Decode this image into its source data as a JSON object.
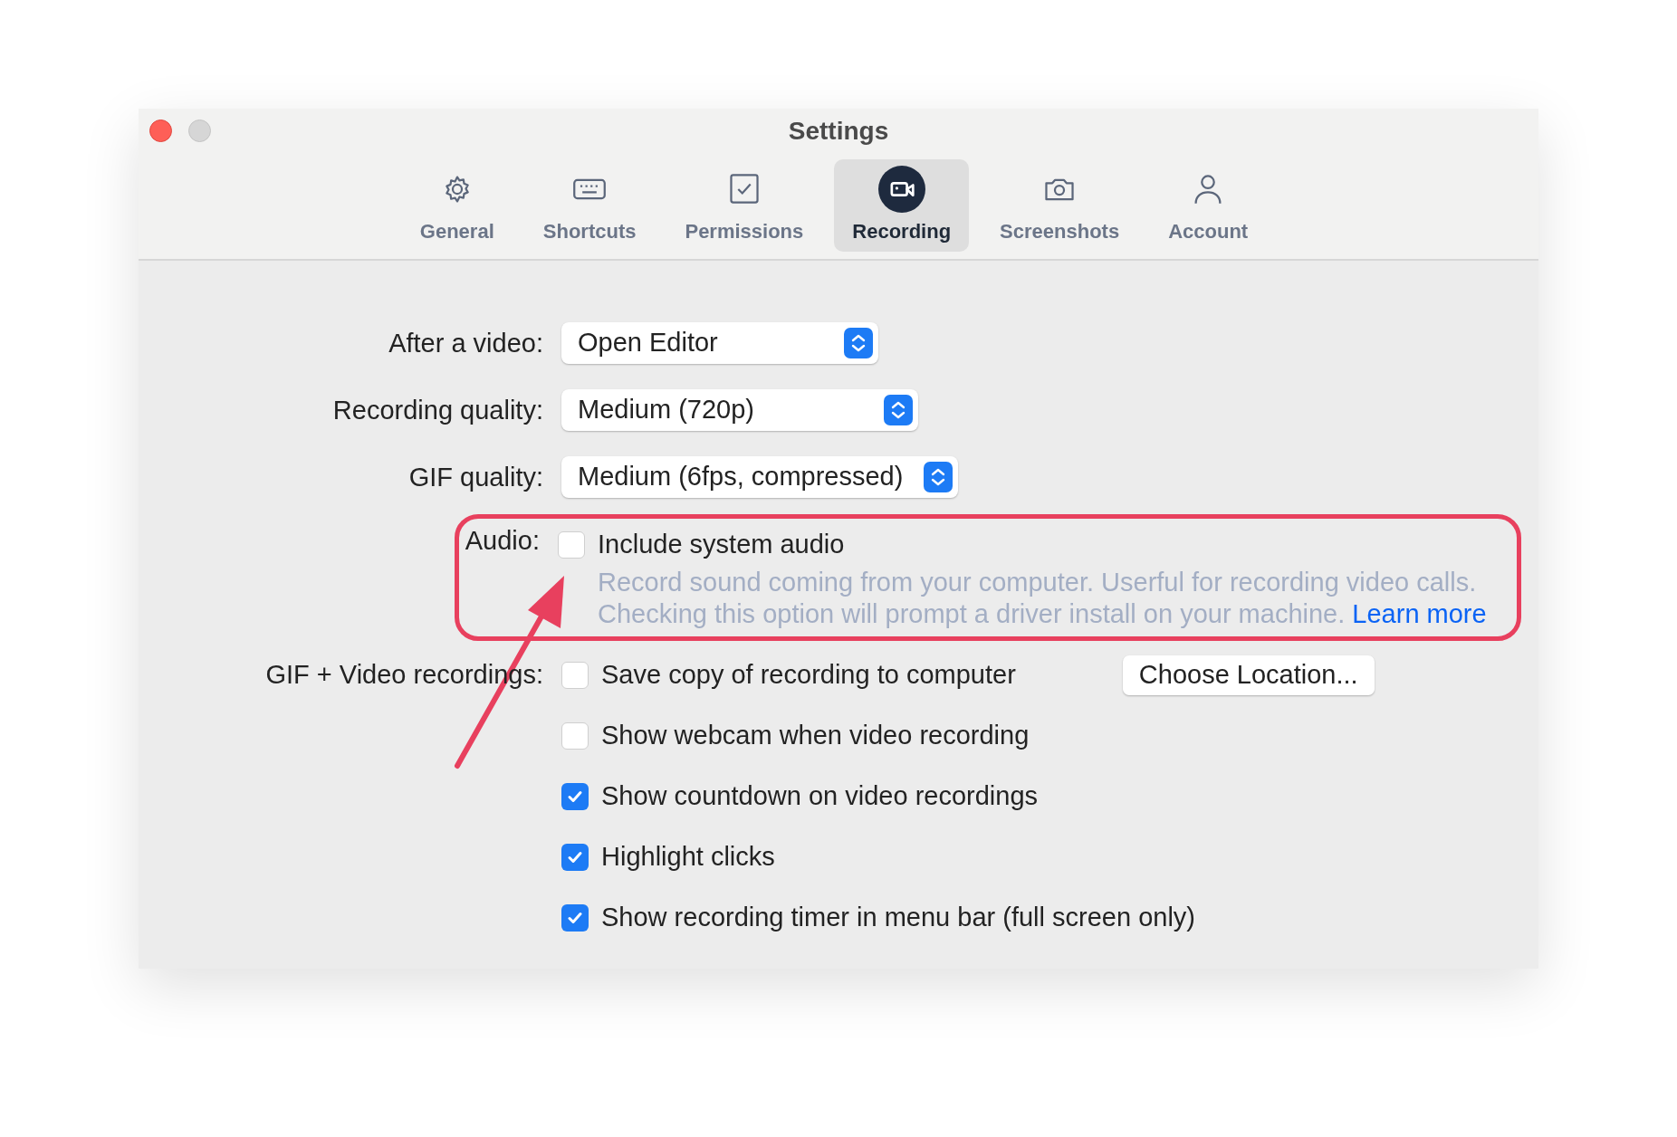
{
  "window": {
    "title": "Settings"
  },
  "tabs": [
    {
      "label": "General",
      "selected": false
    },
    {
      "label": "Shortcuts",
      "selected": false
    },
    {
      "label": "Permissions",
      "selected": false
    },
    {
      "label": "Recording",
      "selected": true
    },
    {
      "label": "Screenshots",
      "selected": false
    },
    {
      "label": "Account",
      "selected": false
    }
  ],
  "dropdowns": [
    {
      "label": "After a video:",
      "value": "Open Editor"
    },
    {
      "label": "Recording quality:",
      "value": "Medium (720p)"
    },
    {
      "label": "GIF quality:",
      "value": "Medium (6fps, compressed)"
    }
  ],
  "audio": {
    "label": "Audio:",
    "option": {
      "label": "Include system audio",
      "checked": false
    },
    "description": [
      "Record sound coming from your computer. Userful for recording video calls.",
      "Checking this option will prompt a driver install on your machine."
    ],
    "link": "Learn more"
  },
  "recordings": {
    "label": "GIF + Video recordings:",
    "button": "Choose Location...",
    "options": [
      {
        "label": "Save copy of recording to computer",
        "checked": false
      },
      {
        "label": "Show webcam when video recording",
        "checked": false
      },
      {
        "label": "Show countdown on video recordings",
        "checked": true
      },
      {
        "label": "Highlight clicks",
        "checked": true
      },
      {
        "label": "Show recording timer in menu bar (full screen only)",
        "checked": true
      }
    ]
  }
}
